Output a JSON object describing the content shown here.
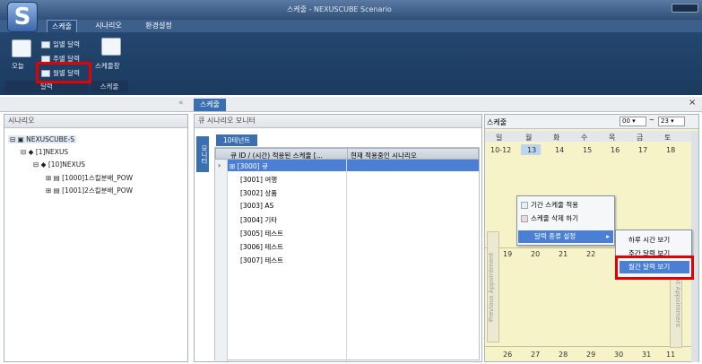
{
  "app": {
    "title": "스케줄 - NEXUSCUBE Scenario",
    "logo": "S"
  },
  "tabs": [
    "스케줄",
    "시나리오",
    "환경설정"
  ],
  "ribbon": {
    "today": "오늘",
    "daily": "일별 달력",
    "weekly": "주별 달력",
    "monthly": "월별 달력",
    "settings": "스케줄창",
    "group_left": "달력",
    "group_right": "스케줄"
  },
  "doc_tab": "스케줄",
  "left": {
    "header": "시나리오",
    "tree": [
      "NEXUSCUBE-S",
      "[1]NEXUS",
      "[10]NEXUS",
      "[1000]1스킬분배_POW",
      "[1001]2스킬분배_POW"
    ]
  },
  "monitor": {
    "header": "큐 시나리오 모니터",
    "side_tab": "모니터",
    "tab": "10테넌트",
    "columns": [
      "큐 ID / (시간) 적용된 스케줄 [...",
      "현재 적용중인 시나리오"
    ],
    "rows": [
      "[3000] 큐",
      "[3001] 여행",
      "[3002] 상품",
      "[3003] AS",
      "[3004] 기타",
      "[3005] 테스트",
      "[3006] 테스트",
      "[3007] 테스트"
    ]
  },
  "calendar": {
    "header": "스케줄",
    "from": "00",
    "to": "23",
    "days": [
      "일",
      "월",
      "화",
      "수",
      "목",
      "금",
      "토"
    ],
    "week1": [
      "10-12",
      "13",
      "14",
      "15",
      "16",
      "17",
      "18"
    ],
    "week2": [
      "19",
      "20",
      "21",
      "22",
      "",
      "",
      ""
    ],
    "week3": [
      "26",
      "27",
      "28",
      "29",
      "30",
      "31",
      "11"
    ],
    "prev": "Previous Appointment",
    "next": "Next Appointment"
  },
  "context_menu": {
    "items": [
      "기간 스케줄 적용",
      "스케줄 삭제 하기",
      "달력 종류 설정"
    ]
  },
  "submenu": {
    "items": [
      "하루 시간 보기",
      "주간 달력 보기",
      "월간 달력 보기"
    ]
  },
  "colors": {
    "accent": "#4a7fd4",
    "highlight": "#e30000"
  }
}
